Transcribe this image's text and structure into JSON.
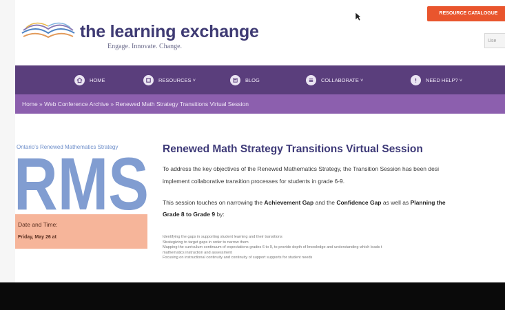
{
  "header": {
    "site_title": "the learning exchange",
    "tagline": "Engage. Innovate. Change.",
    "catalogue_button": "RESOURCE CATALOGUE",
    "search_placeholder": "Use"
  },
  "nav": {
    "items": [
      {
        "label": "HOME",
        "icon": "home-icon"
      },
      {
        "label": "RESOURCES ˅",
        "icon": "resources-icon"
      },
      {
        "label": "BLOG",
        "icon": "blog-icon"
      },
      {
        "label": "COLLABORATE ˅",
        "icon": "collaborate-icon"
      },
      {
        "label": "NEED HELP? ˅",
        "icon": "help-icon"
      }
    ]
  },
  "breadcrumb": "Home » Web Conference Archive » Renewed Math Strategy Transitions Virtual Session",
  "sidebar": {
    "caption": "Ontario's Renewed Mathematics Strategy",
    "logo_text": "RMS",
    "date_label": "Date and Time:",
    "date_value": "Friday, May 26 at"
  },
  "main": {
    "title": "Renewed Math Strategy Transitions Virtual Session",
    "p1_line1": "To address the key objectives of the Renewed Mathematics Strategy, the Transition Session has been desi",
    "p1_line2": "implement collaborative transition processes for students in grade 6-9.",
    "p2_a": "This session touches on narrowing the ",
    "p2_b": "Achievement Gap",
    "p2_c": " and the ",
    "p2_d": "Confidence Gap",
    "p2_e": " as well as ",
    "p2_f": "Planning the",
    "p2_g": "Grade 8 to Grade 9",
    "p2_h": " by:",
    "list": [
      "Identifying the gaps in supporting student learning and their transitions",
      "Strategizing to target gaps in order to narrow them",
      "Mapping the curriculum continuum of expectations grades 6 to 9, to provide depth of knowledge and understanding which leads t",
      "mathematics instruction and assessment",
      "Focusing on instructional continuity and continuity of support supports for student needs"
    ]
  },
  "colors": {
    "nav_bg": "#5a3e7c",
    "breadcrumb_bg": "#8c5fae",
    "title_color": "#3e3a78",
    "accent_orange": "#e9552d",
    "date_box_bg": "#f6b59a",
    "rms_blue": "#6c8dc9"
  }
}
